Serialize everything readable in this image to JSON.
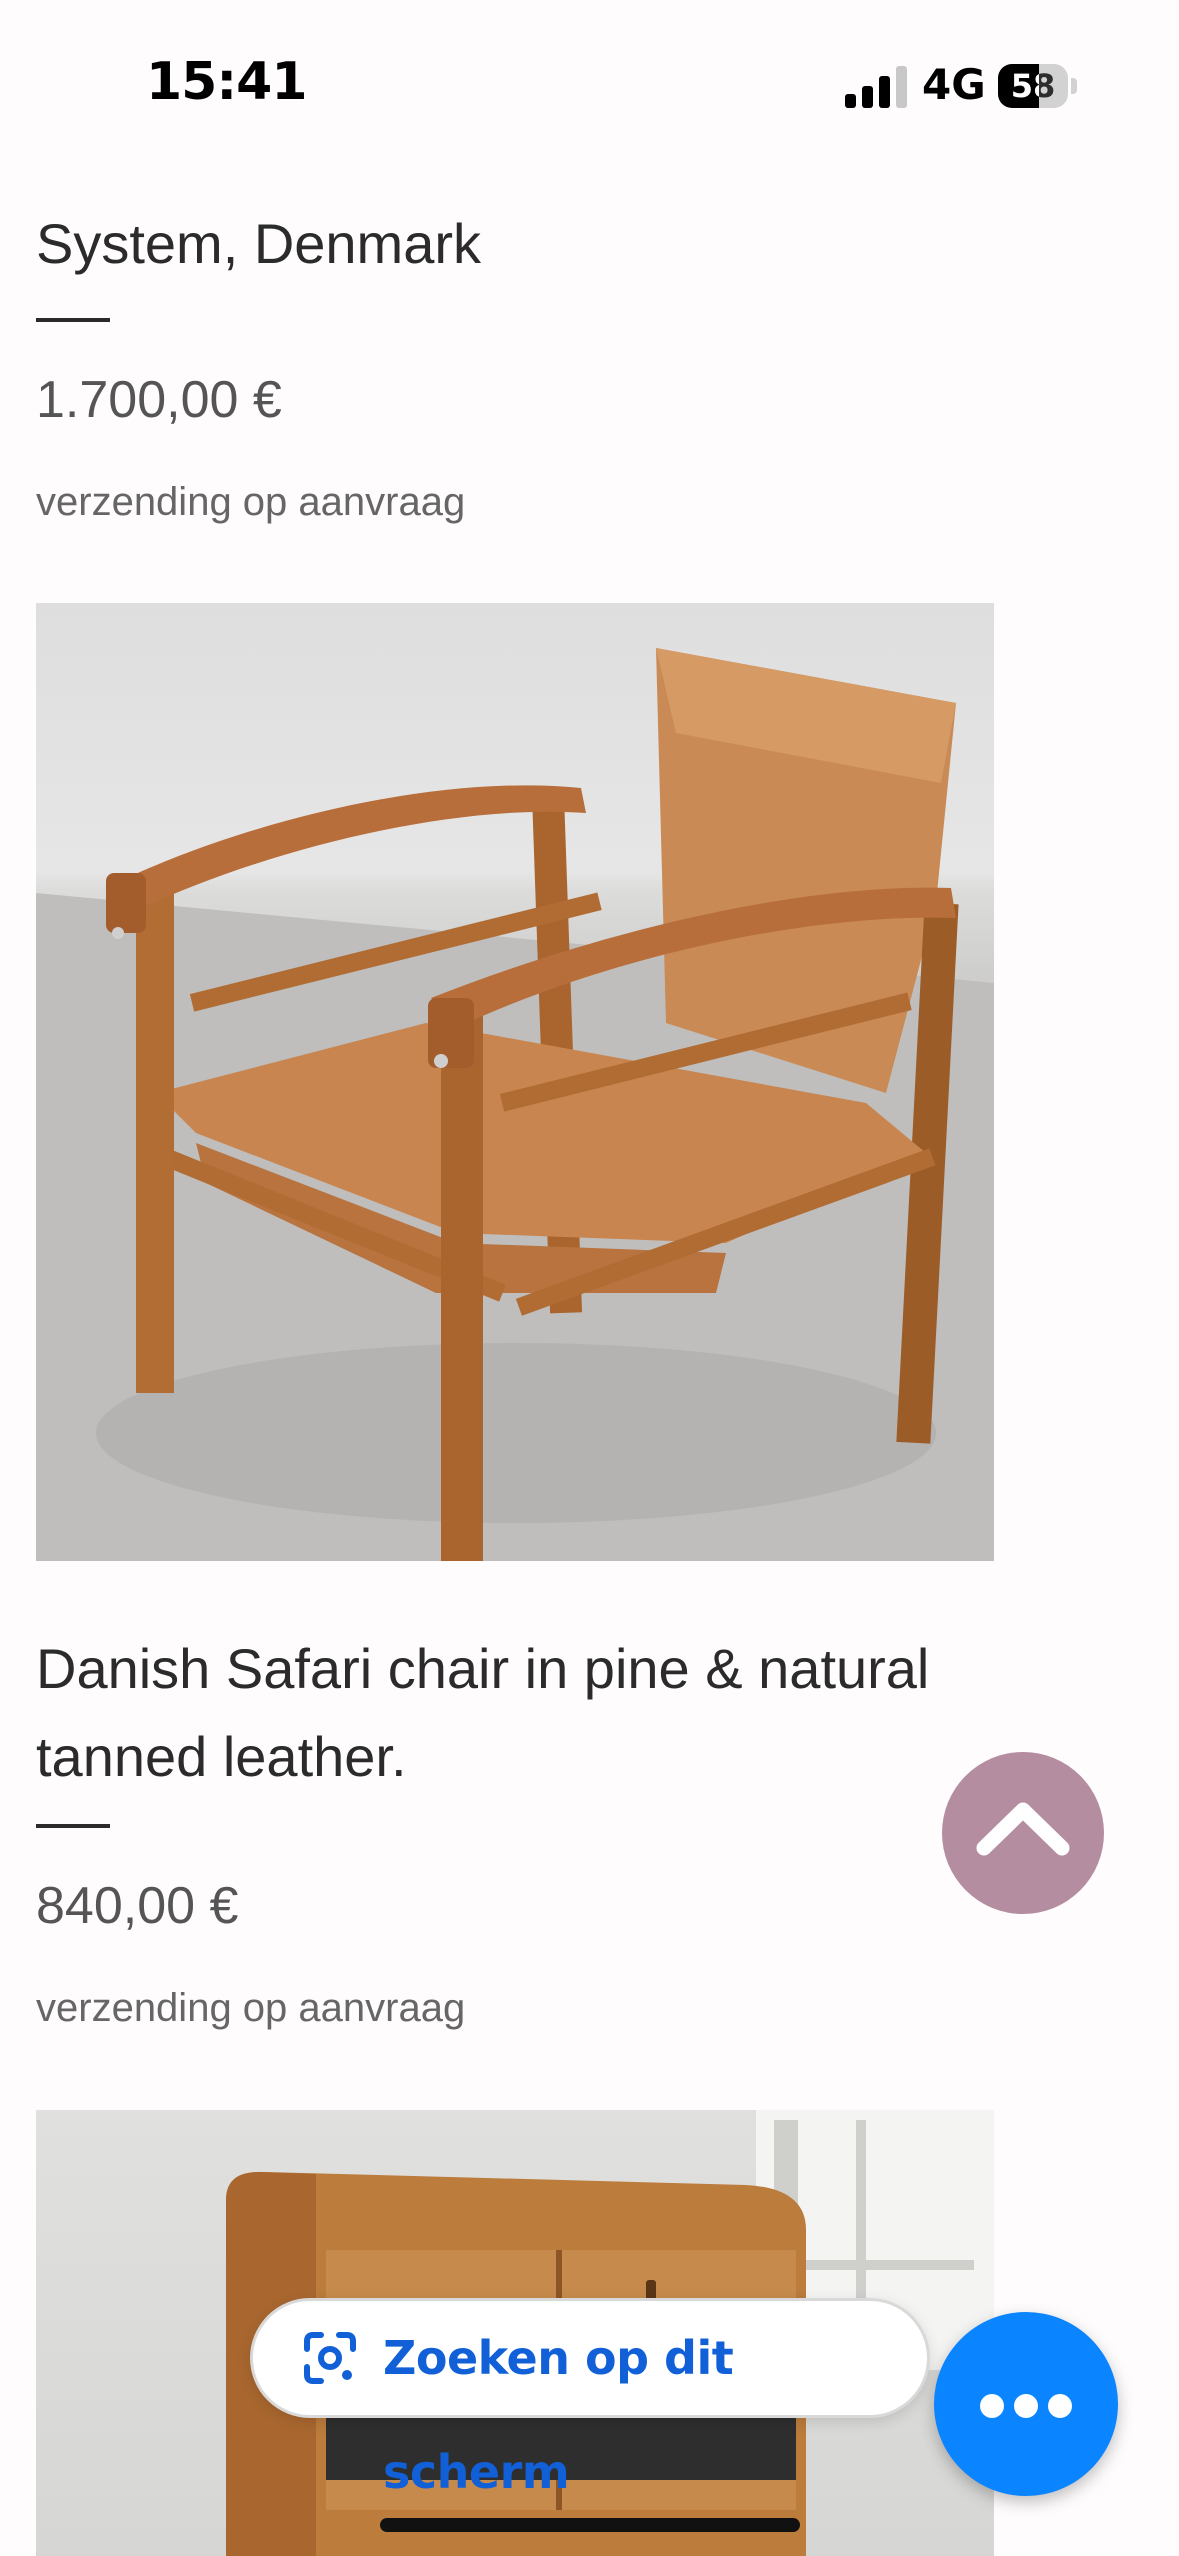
{
  "status_bar": {
    "time": "15:41",
    "network": "4G",
    "battery_level": "58",
    "signal_icon": "cellular-signal-icon",
    "battery_icon": "battery-icon"
  },
  "listing": {
    "previous_item": {
      "title_line": "System, Denmark",
      "price": "1.700,00 €",
      "shipping": "verzending op aanvraag"
    },
    "item": {
      "photo_description_icon": "chair-photo",
      "title": "Danish Safari chair in pine & natural tanned leather.",
      "price": "840,00 €",
      "shipping": "verzending op aanvraag"
    },
    "next_item": {
      "photo_description_icon": "cabinet-photo"
    }
  },
  "overlay": {
    "scroll_top_icon": "chevron-up-icon",
    "search_label": "Zoeken op dit scherm",
    "search_icon": "google-lens-icon",
    "menu_icon": "more-dots-icon"
  },
  "colors": {
    "accent_scroll": "#b48da1",
    "fab_blue": "#0a84ff",
    "search_text": "#1160d8"
  }
}
